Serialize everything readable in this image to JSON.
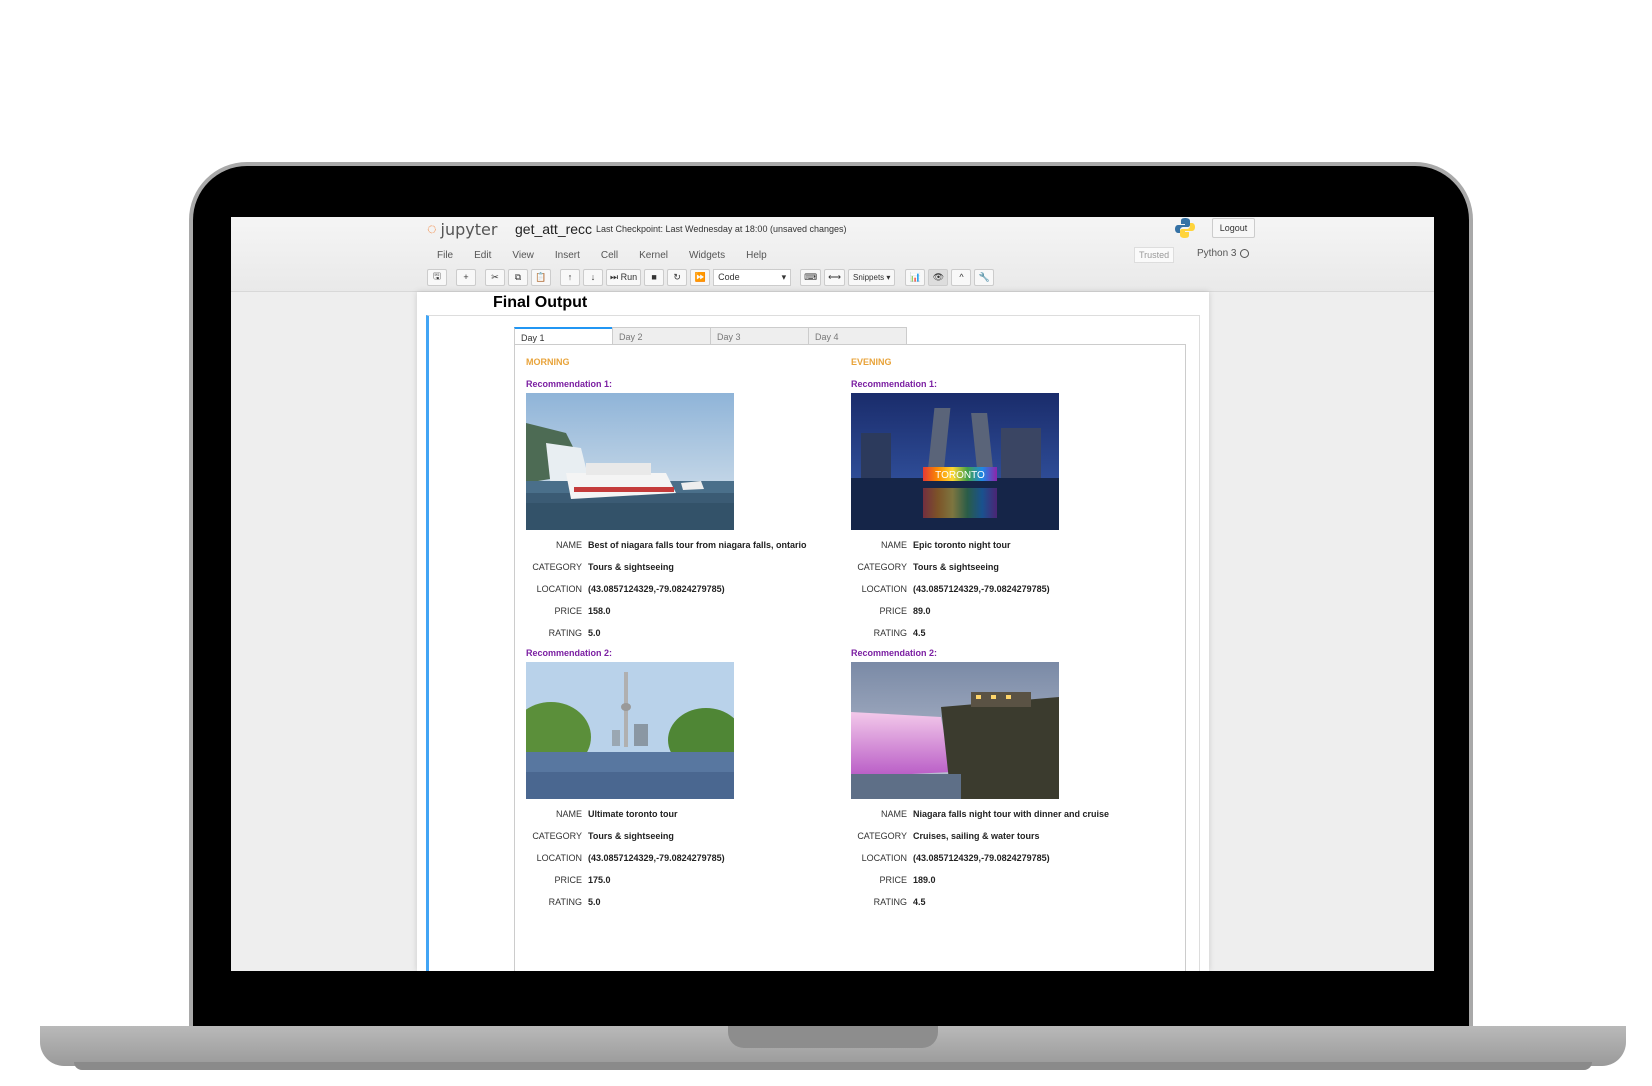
{
  "header": {
    "logo_text": "jupyter",
    "notebook_name": "get_att_recc",
    "checkpoint": "Last Checkpoint: Last Wednesday at 18:00   (unsaved changes)",
    "logout_label": "Logout",
    "trusted_label": "Trusted",
    "kernel_label": "Python 3"
  },
  "menu": [
    "File",
    "Edit",
    "View",
    "Insert",
    "Cell",
    "Kernel",
    "Widgets",
    "Help"
  ],
  "toolbar": {
    "run_label": "Run",
    "cell_type": "Code",
    "snippets_label": "Snippets"
  },
  "output": {
    "title": "Final Output",
    "tabs": [
      "Day 1",
      "Day 2",
      "Day 3",
      "Day 4"
    ],
    "field_labels": {
      "name": "NAME",
      "category": "CATEGORY",
      "location": "LOCATION",
      "price": "PRICE",
      "rating": "RATING"
    },
    "morning": {
      "label": "MORNING",
      "rec1": {
        "title": "Recommendation 1:",
        "name": "Best of niagara falls tour from niagara falls, ontario",
        "category": "Tours & sightseeing",
        "location": "(43.0857124329,-79.0824279785)",
        "price": "158.0",
        "rating": "5.0"
      },
      "rec2": {
        "title": "Recommendation 2:",
        "name": "Ultimate toronto tour",
        "category": "Tours & sightseeing",
        "location": "(43.0857124329,-79.0824279785)",
        "price": "175.0",
        "rating": "5.0"
      }
    },
    "evening": {
      "label": "EVENING",
      "rec1": {
        "title": "Recommendation 1:",
        "name": "Epic toronto night tour",
        "category": "Tours & sightseeing",
        "location": "(43.0857124329,-79.0824279785)",
        "price": "89.0",
        "rating": "4.5",
        "sign_text": "TORONTO"
      },
      "rec2": {
        "title": "Recommendation 2:",
        "name": "Niagara falls night tour with dinner and cruise",
        "category": "Cruises, sailing & water tours",
        "location": "(43.0857124329,-79.0824279785)",
        "price": "189.0",
        "rating": "4.5"
      }
    }
  }
}
